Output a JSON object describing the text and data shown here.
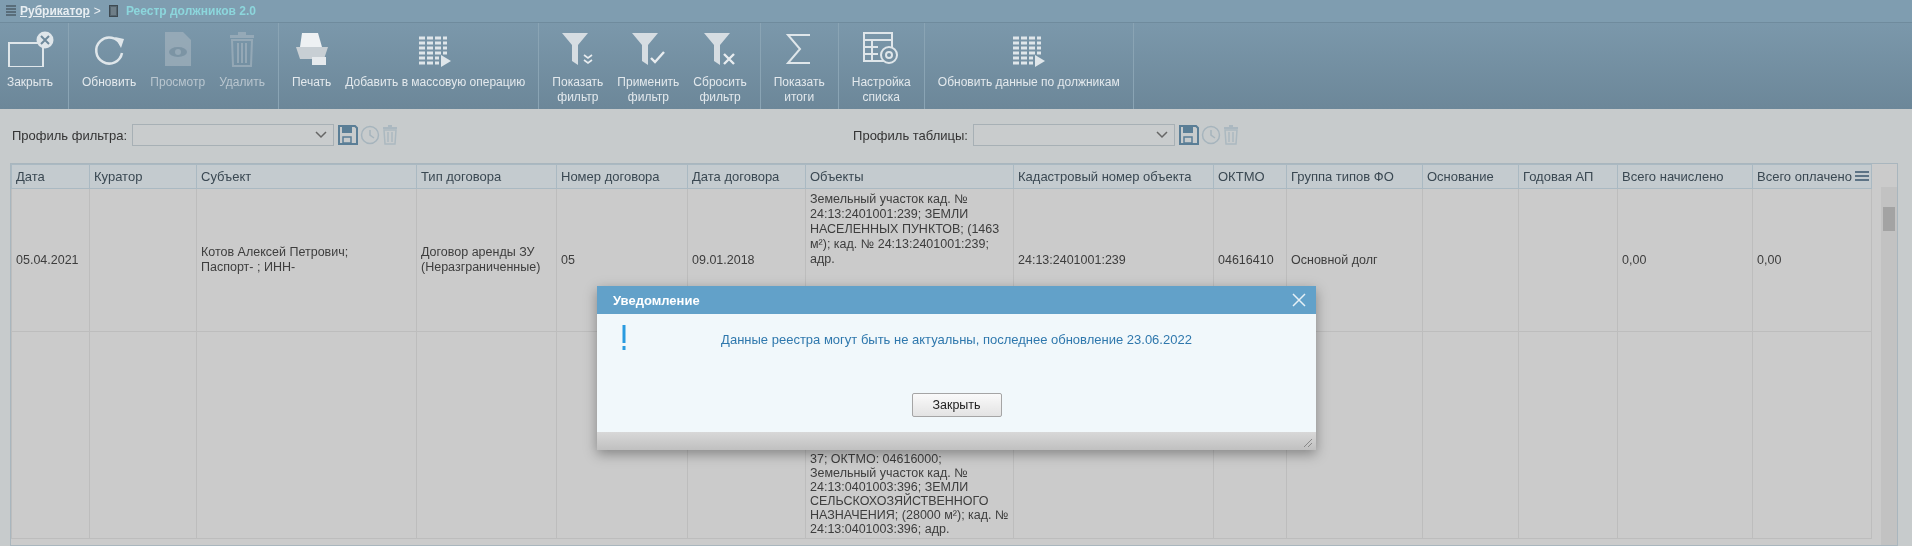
{
  "breadcrumb": {
    "parent": "Рубрикатор",
    "separator": ">",
    "current": "Реестр должников 2.0"
  },
  "toolbar": {
    "groups": [
      [
        {
          "label": "Закрыть",
          "kind": "close",
          "disabled": false
        }
      ],
      [
        {
          "label": "Обновить",
          "kind": "refresh",
          "disabled": false
        },
        {
          "label": "Просмотр",
          "kind": "view",
          "disabled": true
        },
        {
          "label": "Удалить",
          "kind": "delete",
          "disabled": true
        }
      ],
      [
        {
          "label": "Печать",
          "kind": "print",
          "disabled": false
        },
        {
          "label": "Добавить в массовую операцию",
          "kind": "table",
          "disabled": false
        }
      ],
      [
        {
          "label": "Показать\nфильтр",
          "kind": "filter",
          "disabled": false
        },
        {
          "label": "Применить\nфильтр",
          "kind": "apply",
          "disabled": false
        },
        {
          "label": "Сбросить\nфильтр",
          "kind": "reset",
          "disabled": false
        }
      ],
      [
        {
          "label": "Показать\nитоги",
          "kind": "sum",
          "disabled": false
        }
      ],
      [
        {
          "label": "Настройка\nсписка",
          "kind": "settings",
          "disabled": false
        }
      ],
      [
        {
          "label": "Обновить данные по должникам",
          "kind": "table",
          "disabled": false
        }
      ]
    ]
  },
  "profiles": [
    {
      "label": "Профиль фильтра:",
      "restore_disabled": true,
      "delete_disabled": true
    },
    {
      "label": "Профиль таблицы:",
      "restore_disabled": true,
      "delete_disabled": true
    }
  ],
  "table": {
    "columns": [
      "Дата",
      "Куратор",
      "Субъект",
      "Тип договора",
      "Номер договора",
      "Дата договора",
      "Объекты",
      "Кадастровый номер объекта",
      "ОКТМО",
      "Группа типов ФО",
      "Основание",
      "Годовая АП",
      "Всего начислено",
      "Всего оплачено"
    ],
    "rows": [
      {
        "cells": [
          "05.04.2021",
          "",
          "Котов Алексей Петрович;\nПаспорт- ; ИНН-",
          "Договор аренды ЗУ\n(Неразграниченные)",
          "05",
          "09.01.2018",
          "Земельный участок кад. № 24:13:2401001:239; ЗЕМЛИ НАСЕЛЕННЫХ ПУНКТОВ; (1463 м²); кад. № 24:13:2401001:239; адр.",
          "24:13:2401001:239",
          "04616410",
          "Основной долг",
          "",
          "",
          "0,00",
          "0,00"
        ]
      },
      {
        "cells": [
          "",
          "",
          "",
          "",
          "",
          "",
          "37; ОКТМО: 04616000; Земельный участок кад. № 24:13:0401003:396; ЗЕМЛИ СЕЛЬСКОХОЗЯЙСТВЕННОГО НАЗНАЧЕНИЯ; (28000 м²); кад. № 24:13:0401003:396; адр.",
          "",
          "",
          "",
          "",
          "",
          "",
          ""
        ]
      }
    ]
  },
  "dialog": {
    "title": "Уведомление",
    "message": "Данные реестра могут быть не актуальны, последнее обновление 23.06.2022",
    "button": "Закрыть"
  }
}
